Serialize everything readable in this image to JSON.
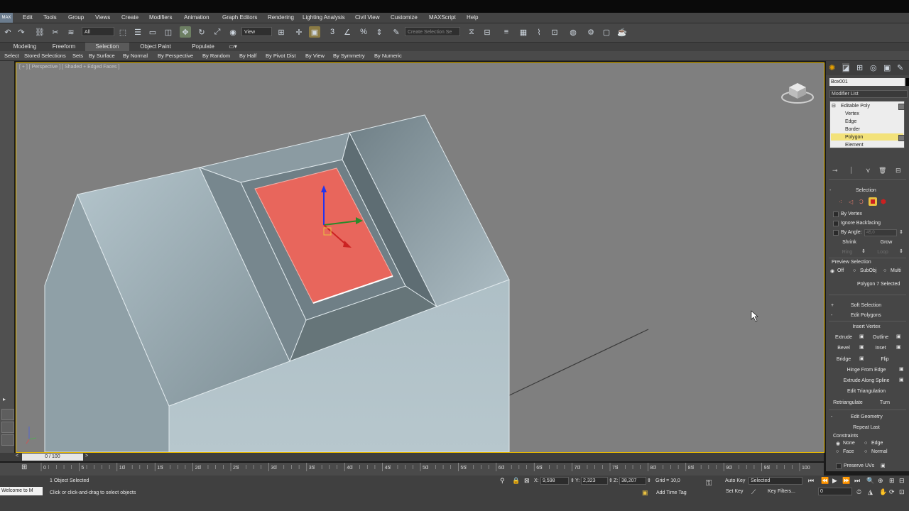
{
  "menu": [
    "Edit",
    "Tools",
    "Group",
    "Views",
    "Create",
    "Modifiers",
    "Animation",
    "Graph Editors",
    "Rendering",
    "Lighting Analysis",
    "Civil View",
    "Customize",
    "MAXScript",
    "Help"
  ],
  "app_logo": "MAX",
  "toolbar": {
    "filter_value": "All",
    "view_value": "View",
    "selection_set_placeholder": "Create Selection Se"
  },
  "ribbon_tabs": [
    "Modeling",
    "Freeform",
    "Selection",
    "Object Paint",
    "Populate"
  ],
  "ribbon_active": "Selection",
  "subbar": [
    "Select",
    "Stored Selections",
    "Sets",
    "By Surface",
    "By Normal",
    "By Perspective",
    "By Random",
    "By Half",
    "By Pivot Dist",
    "By View",
    "By Symmetry",
    "By Numeric"
  ],
  "viewport": {
    "label": "[ + ] [ Perspective ] [ Shaded + Edged Faces ]"
  },
  "command_panel": {
    "object_name": "Box001",
    "modifier_list": "Modifier List",
    "stack": [
      "Editable Poly",
      "Vertex",
      "Edge",
      "Border",
      "Polygon",
      "Element"
    ],
    "stack_selected": "Polygon",
    "selection_title": "Selection",
    "by_vertex": "By Vertex",
    "ignore_backfacing": "Ignore Backfacing",
    "by_angle": "By Angle:",
    "by_angle_value": "45,0",
    "shrink": "Shrink",
    "grow": "Grow",
    "ring": "Ring",
    "loop": "Loop",
    "preview_selection": "Preview Selection",
    "preview_off": "Off",
    "preview_subobj": "SubObj",
    "preview_multi": "Multi",
    "selected_status": "Polygon 7 Selected",
    "soft_selection": "Soft Selection",
    "edit_polygons": "Edit Polygons",
    "insert_vertex": "Insert Vertex",
    "extrude": "Extrude",
    "outline": "Outline",
    "bevel": "Bevel",
    "inset": "Inset",
    "bridge": "Bridge",
    "flip": "Flip",
    "hinge": "Hinge From Edge",
    "extrude_spline": "Extrude Along Spline",
    "edit_triangulation": "Edit Triangulation",
    "retriangulate": "Retriangulate",
    "turn": "Turn",
    "edit_geometry": "Edit Geometry",
    "repeat_last": "Repeat Last",
    "constraints": "Constraints",
    "c_none": "None",
    "c_edge": "Edge",
    "c_face": "Face",
    "c_normal": "Normal",
    "preserve_uvs": "Preserve UVs"
  },
  "timeline": {
    "frame": "0 / 100",
    "ticks": [
      "0",
      "5",
      "10",
      "15",
      "20",
      "25",
      "30",
      "35",
      "40",
      "45",
      "50",
      "55",
      "60",
      "65",
      "70",
      "75",
      "80",
      "85",
      "90",
      "95",
      "100"
    ]
  },
  "status": {
    "maxscript": "Welcome to M",
    "objects_selected": "1 Object Selected",
    "prompt": "Click or click-and-drag to select objects",
    "x_label": "X:",
    "x_value": "9,598",
    "y_label": "Y:",
    "y_value": "2,323",
    "z_label": "Z:",
    "z_value": "38,207",
    "grid": "Grid = 10,0",
    "add_time_tag": "Add Time Tag",
    "auto_key": "Auto Key",
    "set_key": "Set Key",
    "key_mode": "Selected",
    "key_filters": "Key Filters...",
    "current_frame": "0"
  },
  "colors": {
    "selected_polygon": "#e8665c",
    "viewport_border": "#f0c000",
    "stack_highlight": "#f3e27a"
  }
}
